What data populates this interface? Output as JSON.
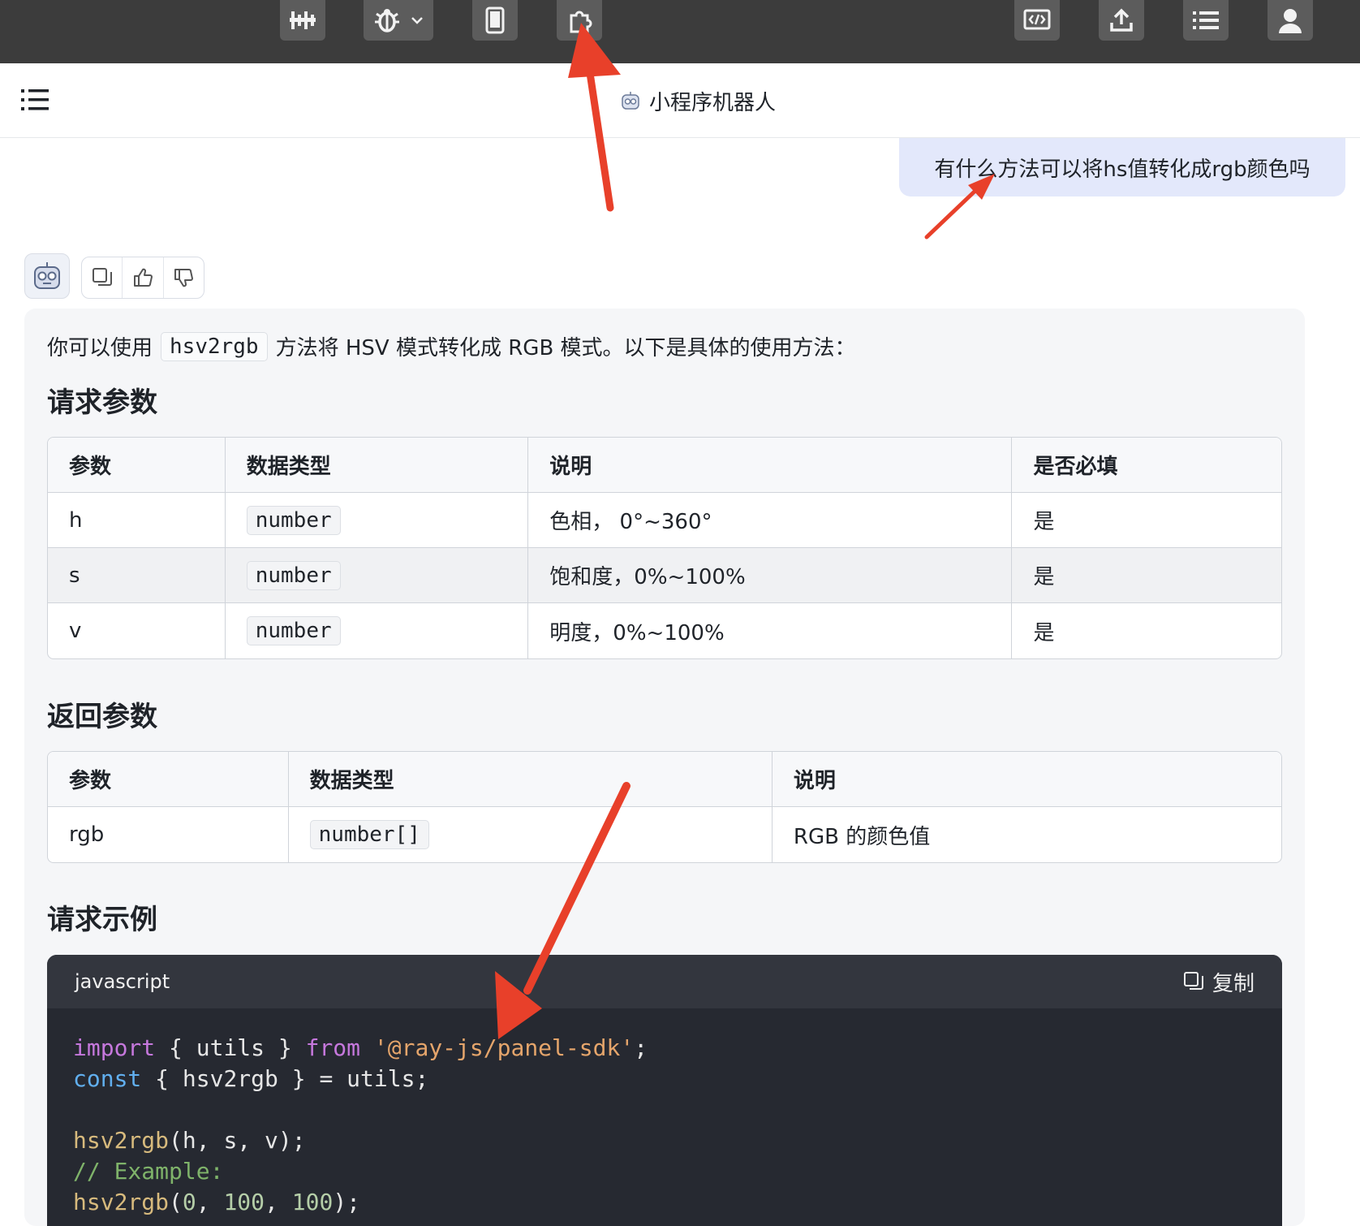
{
  "header": {
    "title": "小程序机器人"
  },
  "user_message": "有什么方法可以将hs值转化成rgb颜色吗",
  "answer": {
    "intro_before": "你可以使用",
    "intro_code": "hsv2rgb",
    "intro_after": "方法将 HSV 模式转化成 RGB 模式。以下是具体的使用方法：",
    "request_title": "请求参数",
    "request_table": {
      "headers": [
        "参数",
        "数据类型",
        "说明",
        "是否必填"
      ],
      "rows": [
        [
          "h",
          "number",
          "色相， 0°~360°",
          "是"
        ],
        [
          "s",
          "number",
          "饱和度，0%~100%",
          "是"
        ],
        [
          "v",
          "number",
          "明度，0%~100%",
          "是"
        ]
      ]
    },
    "return_title": "返回参数",
    "return_table": {
      "headers": [
        "参数",
        "数据类型",
        "说明"
      ],
      "rows": [
        [
          "rgb",
          "number[]",
          "RGB 的颜色值"
        ]
      ]
    },
    "example_title": "请求示例",
    "code": {
      "language": "javascript",
      "copy_label": "复制",
      "l1_kw": "import",
      "l1_a": " { utils } ",
      "l1_kw2": "from",
      "l1_str": "'@ray-js/panel-sdk'",
      "l1_end": ";",
      "l2_kw": "const",
      "l2_rest": " { hsv2rgb } = utils;",
      "l3_fn": "hsv2rgb",
      "l3_rest": "(h, s, v);",
      "l4_cmt": "// Example:",
      "l5_fn": "hsv2rgb",
      "l5_open": "(",
      "l5_n1": "0",
      "l5_c1": ", ",
      "l5_n2": "100",
      "l5_c2": ", ",
      "l5_n3": "100",
      "l5_end": ");"
    }
  },
  "colors": {
    "toolbar": "#3c3c3c",
    "user_bubble": "#e3e8fb",
    "arrow": "#e8402a",
    "code_bg": "#262931"
  }
}
